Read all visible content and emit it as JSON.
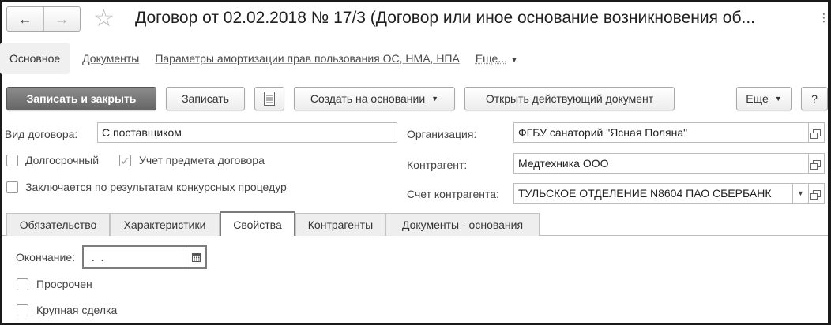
{
  "window": {
    "title": "Договор от 02.02.2018 № 17/3 (Договор или иное основание возникновения об...",
    "back_icon": "←",
    "forward_icon": "→",
    "star_icon": "☆",
    "menu_icon": "⋮"
  },
  "subtabs": {
    "main": "Основное",
    "documents": "Документы",
    "amortization": "Параметры амортизации прав пользования ОС, НМА, НПА",
    "more": "Еще..."
  },
  "toolbar": {
    "save_close": "Записать и закрыть",
    "save": "Записать",
    "create_based": "Создать на основании",
    "open_current_doc": "Открыть действующий документ",
    "more": "Еще",
    "help": "?"
  },
  "form": {
    "contract_type_label": "Вид договора:",
    "contract_type_value": "С поставщиком",
    "long_term_label": "Долгосрочный",
    "long_term_checked": false,
    "subject_accounting_label": "Учет предмета договора",
    "subject_accounting_checked": true,
    "tender_label": "Заключается по результатам конкурсных процедур",
    "tender_checked": false,
    "organization_label": "Организация:",
    "organization_value": "ФГБУ санаторий \"Ясная Поляна\"",
    "counterparty_label": "Контрагент:",
    "counterparty_value": "Медтехника ООО",
    "account_label": "Счет контрагента:",
    "account_value": "ТУЛЬСКОЕ ОТДЕЛЕНИЕ N8604 ПАО СБЕРБАНК"
  },
  "tabs": [
    {
      "label": "Обязательство"
    },
    {
      "label": "Характеристики"
    },
    {
      "label": "Свойства"
    },
    {
      "label": "Контрагенты"
    },
    {
      "label": "Документы - основания"
    }
  ],
  "active_tab": "Свойства",
  "properties": {
    "end_label": "Окончание:",
    "end_value": " .  .",
    "overdue_label": "Просрочен",
    "overdue_checked": false,
    "major_deal_label": "Крупная сделка",
    "major_deal_checked": false
  },
  "colors": {
    "primary_button": "#777777",
    "active_tab_border": "#7b7b7b"
  }
}
